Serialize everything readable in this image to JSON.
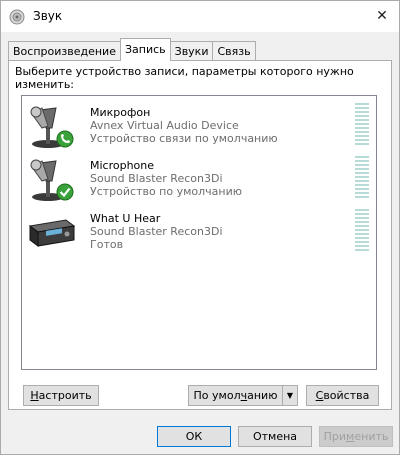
{
  "window": {
    "title": "Звук",
    "close_glyph": "✕"
  },
  "tabs": [
    {
      "label": "Воспроизведение",
      "active": false
    },
    {
      "label": "Запись",
      "active": true
    },
    {
      "label": "Звуки",
      "active": false
    },
    {
      "label": "Связь",
      "active": false
    }
  ],
  "instruction": "Выберите устройство записи, параметры которого нужно изменить:",
  "devices": [
    {
      "name": "Микрофон",
      "driver": "Avnex Virtual Audio Device",
      "status": "Устройство связи по умолчанию",
      "icon": "microphone-icon",
      "badge": "phone-badge-icon"
    },
    {
      "name": "Microphone",
      "driver": "Sound Blaster Recon3Di",
      "status": "Устройство по умолчанию",
      "icon": "microphone-icon",
      "badge": "checkmark-badge-icon"
    },
    {
      "name": "What U Hear",
      "driver": "Sound Blaster Recon3Di",
      "status": "Готов",
      "icon": "sound-card-icon",
      "badge": ""
    }
  ],
  "buttons": {
    "configure_mnemonic": "Н",
    "configure_rest": "астроить",
    "default_pre": "По умол",
    "default_mnemonic": "ч",
    "default_post": "анию",
    "default_arrow": "▼",
    "properties_mnemonic": "С",
    "properties_rest": "войства",
    "ok": "ОК",
    "cancel": "Отмена",
    "apply_pre": "При",
    "apply_mnemonic": "м",
    "apply_post": "енить"
  },
  "colors": {
    "badge_green": "#3aa23a",
    "meter": "#b7dcd8",
    "accent_border": "#0078d7"
  }
}
